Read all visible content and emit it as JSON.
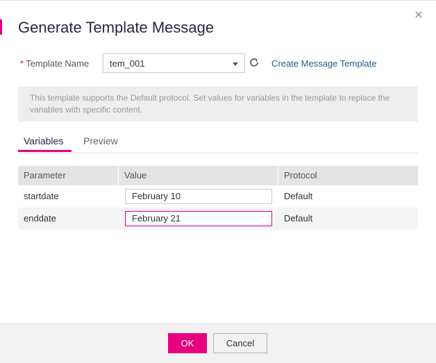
{
  "dialog": {
    "title": "Generate Template Message",
    "close_icon": "close-icon"
  },
  "form": {
    "required_marker": "*",
    "template_name_label": "Template Name",
    "template_name_value": "tem_001",
    "refresh_icon": "refresh-icon",
    "create_link": "Create Message Template"
  },
  "info_text": "This template supports the Default protocol. Set values for variables in the template to replace the variables with specific content.",
  "tabs": [
    {
      "label": "Variables",
      "active": true
    },
    {
      "label": "Preview",
      "active": false
    }
  ],
  "table": {
    "headers": [
      "Parameter",
      "Value",
      "Protocol"
    ],
    "rows": [
      {
        "parameter": "startdate",
        "value": "February 10",
        "protocol": "Default"
      },
      {
        "parameter": "enddate",
        "value": "February 21",
        "protocol": "Default"
      }
    ]
  },
  "footer": {
    "ok_label": "OK",
    "cancel_label": "Cancel"
  },
  "colors": {
    "accent": "#e5007f",
    "link": "#1e5a8c",
    "info_bg": "#eeeeee",
    "header_bg": "#e4e4e4"
  }
}
